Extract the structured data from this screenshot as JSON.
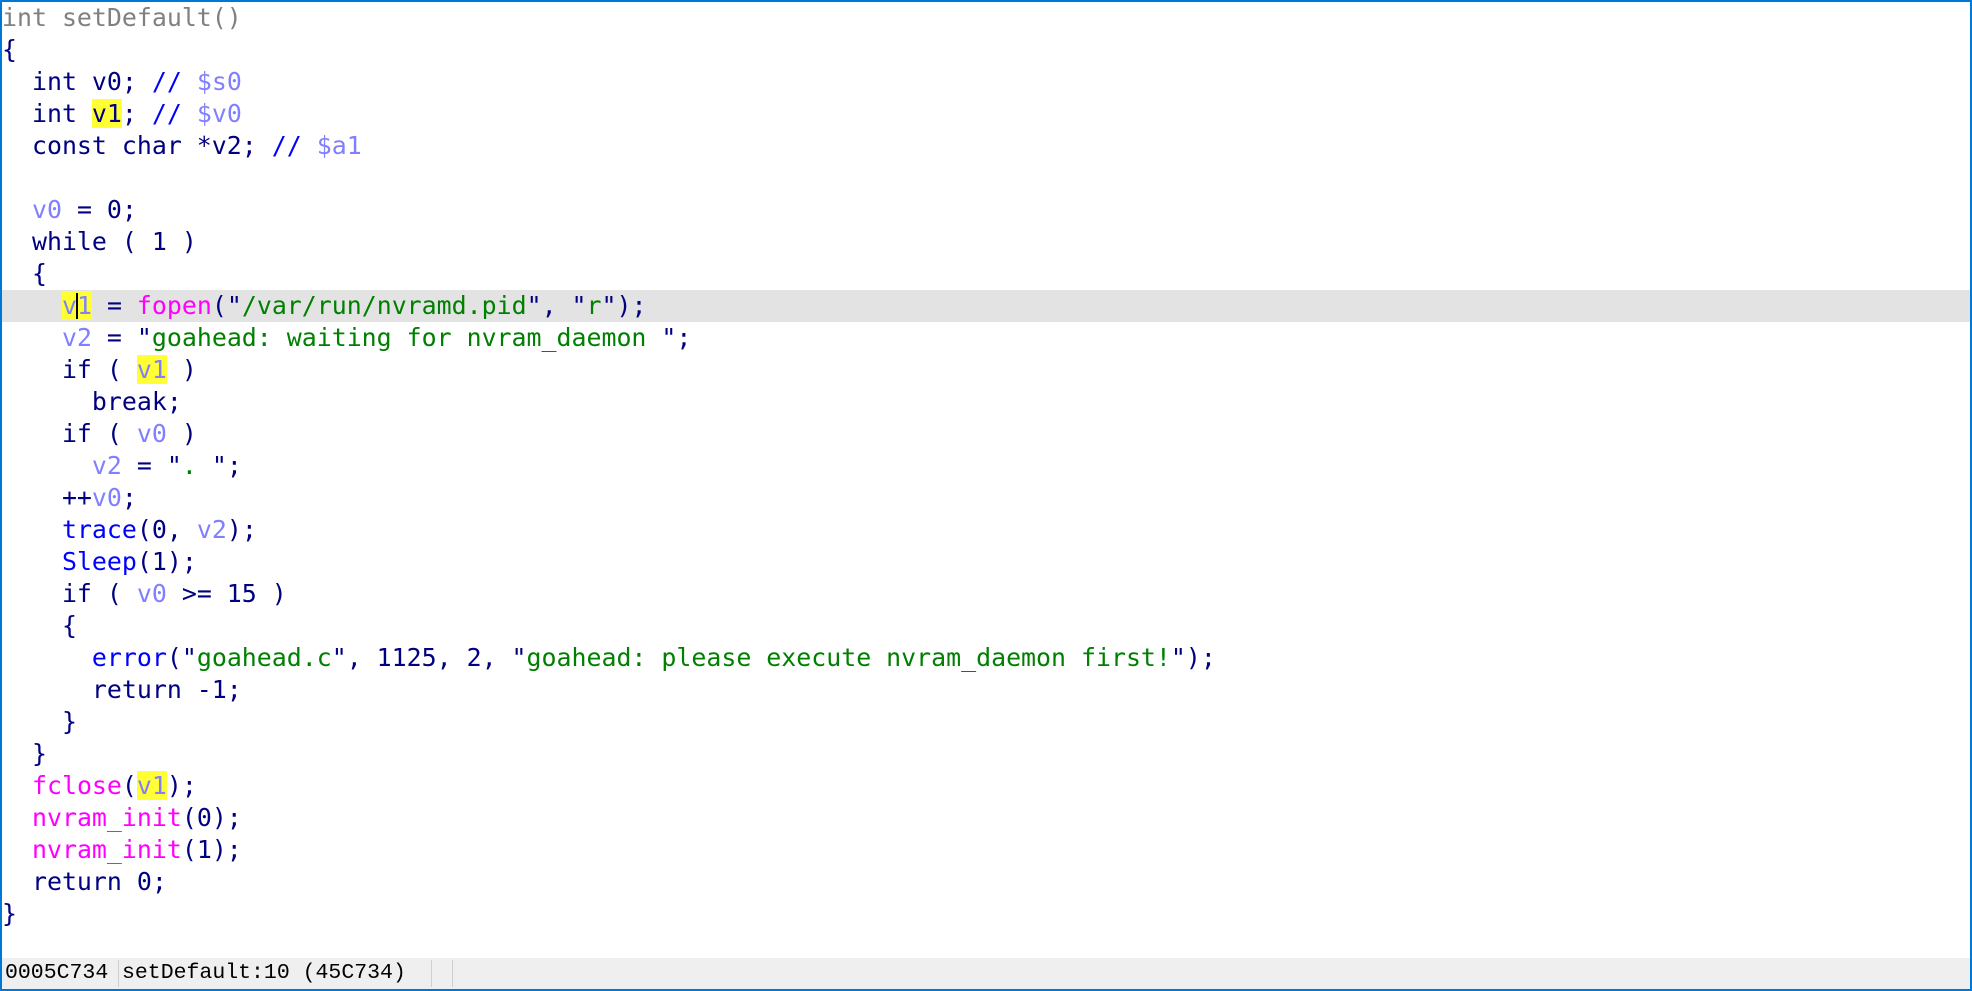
{
  "window": {
    "border_color": "#0078d7"
  },
  "editor": {
    "view": "pseudocode",
    "function_name": "setDefault",
    "current_line_index": 9,
    "highlighted_identifier": "v1",
    "colors": {
      "text": "#000080",
      "comment": "#0000ff",
      "local_variable": "#8080ff",
      "string": "#008000",
      "function_call": "#0000ff",
      "imported_function": "#ff00ff",
      "header": "#808080",
      "highlight": "#ffff33",
      "current_line": "#e3e3e3"
    },
    "lines": [
      [
        {
          "t": "int setDefault()",
          "c": "hdr"
        }
      ],
      [
        {
          "t": "{",
          "c": "kw"
        }
      ],
      [
        {
          "t": "  int ",
          "c": "ty"
        },
        {
          "t": "v0",
          "c": "ty"
        },
        {
          "t": "; ",
          "c": "kw"
        },
        {
          "t": "// ",
          "c": "cm"
        },
        {
          "t": "$s0",
          "c": "reg"
        }
      ],
      [
        {
          "t": "  int ",
          "c": "ty"
        },
        {
          "t": "v1",
          "c": "ty",
          "hl": true
        },
        {
          "t": "; ",
          "c": "kw"
        },
        {
          "t": "// ",
          "c": "cm"
        },
        {
          "t": "$v0",
          "c": "reg"
        }
      ],
      [
        {
          "t": "  const char *v2; ",
          "c": "ty"
        },
        {
          "t": "// ",
          "c": "cm"
        },
        {
          "t": "$a1",
          "c": "reg"
        }
      ],
      [
        {
          "t": "",
          "c": "kw"
        }
      ],
      [
        {
          "t": "  ",
          "c": "kw"
        },
        {
          "t": "v0",
          "c": "var"
        },
        {
          "t": " = 0;",
          "c": "kw"
        }
      ],
      [
        {
          "t": "  while ( 1 )",
          "c": "kw"
        }
      ],
      [
        {
          "t": "  {",
          "c": "kw"
        }
      ],
      [
        {
          "t": "    ",
          "c": "kw"
        },
        {
          "t": "v1",
          "c": "var",
          "hl": true,
          "caret": 1
        },
        {
          "t": " = ",
          "c": "kw"
        },
        {
          "t": "fopen",
          "c": "imp"
        },
        {
          "t": "(\"",
          "c": "kw"
        },
        {
          "t": "/var/run/nvramd.pid",
          "c": "str"
        },
        {
          "t": "\", \"",
          "c": "kw"
        },
        {
          "t": "r",
          "c": "str"
        },
        {
          "t": "\");",
          "c": "kw"
        }
      ],
      [
        {
          "t": "    ",
          "c": "kw"
        },
        {
          "t": "v2",
          "c": "var"
        },
        {
          "t": " = \"",
          "c": "kw"
        },
        {
          "t": "goahead: waiting for nvram_daemon ",
          "c": "str"
        },
        {
          "t": "\";",
          "c": "kw"
        }
      ],
      [
        {
          "t": "    if ( ",
          "c": "kw"
        },
        {
          "t": "v1",
          "c": "var",
          "hl": true
        },
        {
          "t": " )",
          "c": "kw"
        }
      ],
      [
        {
          "t": "      break;",
          "c": "kw"
        }
      ],
      [
        {
          "t": "    if ( ",
          "c": "kw"
        },
        {
          "t": "v0",
          "c": "var"
        },
        {
          "t": " )",
          "c": "kw"
        }
      ],
      [
        {
          "t": "      ",
          "c": "kw"
        },
        {
          "t": "v2",
          "c": "var"
        },
        {
          "t": " = \"",
          "c": "kw"
        },
        {
          "t": ". ",
          "c": "str"
        },
        {
          "t": "\";",
          "c": "kw"
        }
      ],
      [
        {
          "t": "    ++",
          "c": "kw"
        },
        {
          "t": "v0",
          "c": "var"
        },
        {
          "t": ";",
          "c": "kw"
        }
      ],
      [
        {
          "t": "    ",
          "c": "kw"
        },
        {
          "t": "trace",
          "c": "fn"
        },
        {
          "t": "(0, ",
          "c": "kw"
        },
        {
          "t": "v2",
          "c": "var"
        },
        {
          "t": ");",
          "c": "kw"
        }
      ],
      [
        {
          "t": "    ",
          "c": "kw"
        },
        {
          "t": "Sleep",
          "c": "fn"
        },
        {
          "t": "(1);",
          "c": "kw"
        }
      ],
      [
        {
          "t": "    if ( ",
          "c": "kw"
        },
        {
          "t": "v0",
          "c": "var"
        },
        {
          "t": " >= 15 )",
          "c": "kw"
        }
      ],
      [
        {
          "t": "    {",
          "c": "kw"
        }
      ],
      [
        {
          "t": "      ",
          "c": "kw"
        },
        {
          "t": "error",
          "c": "fn"
        },
        {
          "t": "(\"",
          "c": "kw"
        },
        {
          "t": "goahead.c",
          "c": "str"
        },
        {
          "t": "\", 1125, 2, \"",
          "c": "kw"
        },
        {
          "t": "goahead: please execute nvram_daemon first!",
          "c": "str"
        },
        {
          "t": "\");",
          "c": "kw"
        }
      ],
      [
        {
          "t": "      return -1;",
          "c": "kw"
        }
      ],
      [
        {
          "t": "    }",
          "c": "kw"
        }
      ],
      [
        {
          "t": "  }",
          "c": "kw"
        }
      ],
      [
        {
          "t": "  ",
          "c": "kw"
        },
        {
          "t": "fclose",
          "c": "imp"
        },
        {
          "t": "(",
          "c": "kw"
        },
        {
          "t": "v1",
          "c": "var",
          "hl": true
        },
        {
          "t": ");",
          "c": "kw"
        }
      ],
      [
        {
          "t": "  ",
          "c": "kw"
        },
        {
          "t": "nvram_init",
          "c": "imp"
        },
        {
          "t": "(0);",
          "c": "kw"
        }
      ],
      [
        {
          "t": "  ",
          "c": "kw"
        },
        {
          "t": "nvram_init",
          "c": "imp"
        },
        {
          "t": "(1);",
          "c": "kw"
        }
      ],
      [
        {
          "t": "  return 0;",
          "c": "kw"
        }
      ],
      [
        {
          "t": "}",
          "c": "kw"
        }
      ]
    ]
  },
  "status_bar": {
    "address": "0005C734",
    "location": "setDefault:10 (45C734)",
    "extra": ""
  }
}
